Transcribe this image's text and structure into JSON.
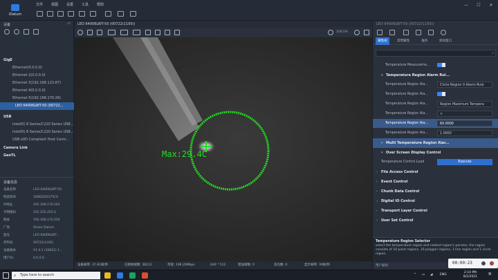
{
  "app": {
    "logo_text": "iDatum",
    "brand_color": "#2b7de0"
  },
  "menu": [
    "文件",
    "视图",
    "设置",
    "工具",
    "帮助"
  ],
  "window_controls": [
    "—",
    "☐",
    "✕"
  ],
  "left": {
    "header": "设备",
    "tree": [
      {
        "label": "GigE",
        "type": "group"
      },
      {
        "label": "Ethernet(0.0.0.0)",
        "type": "item"
      },
      {
        "label": "Ethernet 2(0.0.0.0)",
        "type": "item"
      },
      {
        "label": "Ethernet 3(192.168.123.87)",
        "type": "item"
      },
      {
        "label": "Ethernet 4(0.0.0.0)",
        "type": "item"
      },
      {
        "label": "Ethernet 5(192.168.170.26)",
        "type": "item"
      },
      {
        "label": "LEO 64006LWT-50 (00722...",
        "type": "selected"
      },
      {
        "label": "USB",
        "type": "group"
      },
      {
        "label": "Intel(R) 8 Series/C220 Series USB...",
        "type": "item"
      },
      {
        "label": "Intel(R) 8 Series/C220 Series USB...",
        "type": "item"
      },
      {
        "label": "USB eXO Compliant Host Contr...",
        "type": "item"
      },
      {
        "label": "Camera Link",
        "type": "group"
      },
      {
        "label": "GenTL",
        "type": "group"
      }
    ],
    "info_header": "设备信息",
    "info": [
      {
        "k": "设备名称",
        "v": "LEO 64006LWT-50"
      },
      {
        "k": "制造商ID",
        "v": "34BD2D0375C6"
      },
      {
        "k": "IP地址",
        "v": "192.168.170.163"
      },
      {
        "k": "子网掩码",
        "v": "255.255.255.0"
      },
      {
        "k": "网关",
        "v": "192.168.170.254"
      },
      {
        "k": "厂商",
        "v": "Vision Datum"
      },
      {
        "k": "型号",
        "v": "LEO 64006LWT-..."
      },
      {
        "k": "序列号",
        "v": "00722(1195)"
      },
      {
        "k": "设备版本",
        "v": "V1.0.1 (30622) 1..."
      },
      {
        "k": "用户ID",
        "v": "0.0.0.0"
      }
    ]
  },
  "camera": {
    "title": "LEO 64006LWT-50 (00722(1195))",
    "zoom": "100.0%",
    "overlay_label": "Max:29.4C",
    "overlay_color": "#22dd22",
    "status": [
      "设备帧率: 37.81帧/秒",
      "已接收帧数: 38112",
      "带宽: 198.26Mbps",
      "640 * 512",
      "错误帧数: 0",
      "丢包数: 0",
      "显示帧率: 30帧/秒"
    ]
  },
  "right": {
    "title": "LEO 64006LWT-50 (00722(1195))",
    "tabs": [
      "属性树",
      "常用属性",
      "服务",
      "调试窗口"
    ],
    "rows": [
      {
        "kind": "prop",
        "k": "Temperature Measureme...",
        "v": "",
        "toggle": true
      },
      {
        "kind": "sub",
        "t": "Temperature Region Alarm Rul..."
      },
      {
        "kind": "prop",
        "k": "Temperature Region Ala...",
        "v": "Circle Region 0 Alarm Rule"
      },
      {
        "kind": "prop",
        "k": "Temperature Region Ala...",
        "v": "",
        "toggle": true
      },
      {
        "kind": "prop",
        "k": "Temperature Region Ala...",
        "v": "Region Maximum Tempera"
      },
      {
        "kind": "prop",
        "k": "Temperature Region Ala...",
        "v": ">"
      },
      {
        "kind": "prop",
        "k": "Temperature Region Ala...",
        "v": "60.0000",
        "hl": true
      },
      {
        "kind": "prop",
        "k": "Temperature Region Ala...",
        "v": "1.0000"
      },
      {
        "kind": "sub",
        "t": "Multi Temperature Region Alar...",
        "hl": true
      },
      {
        "kind": "sub",
        "t": "Over Screen Display Control"
      },
      {
        "kind": "exec",
        "k": "Temperature Control Load",
        "v": "Execute"
      },
      {
        "kind": "sect",
        "t": "File Access Control"
      },
      {
        "kind": "sect",
        "t": "Event Control"
      },
      {
        "kind": "sect",
        "t": "Chunk Data Control"
      },
      {
        "kind": "sect",
        "t": "Digital IO Control"
      },
      {
        "kind": "sect",
        "t": "Transport Layer Control"
      },
      {
        "kind": "sect",
        "t": "User Set Control"
      }
    ],
    "desc_title": "Temperature Region Selector",
    "desc_body": "select the temperature region and related region's params. the region consists of 10 point regions, 10 polygon regions, 1 line region and 1 circle region.",
    "user_def": "用户级别"
  },
  "recorder": {
    "time": "00:00:23"
  },
  "taskbar": {
    "search_placeholder": "Type here to search",
    "lang": "ENG",
    "time": "2:10 PM",
    "date": "8/2/2021",
    "app_colors": [
      "#e8b923",
      "#2d7be0",
      "#1aa260",
      "#e04a2d",
      "#9b59b6",
      "#2e86de",
      "#555"
    ]
  }
}
